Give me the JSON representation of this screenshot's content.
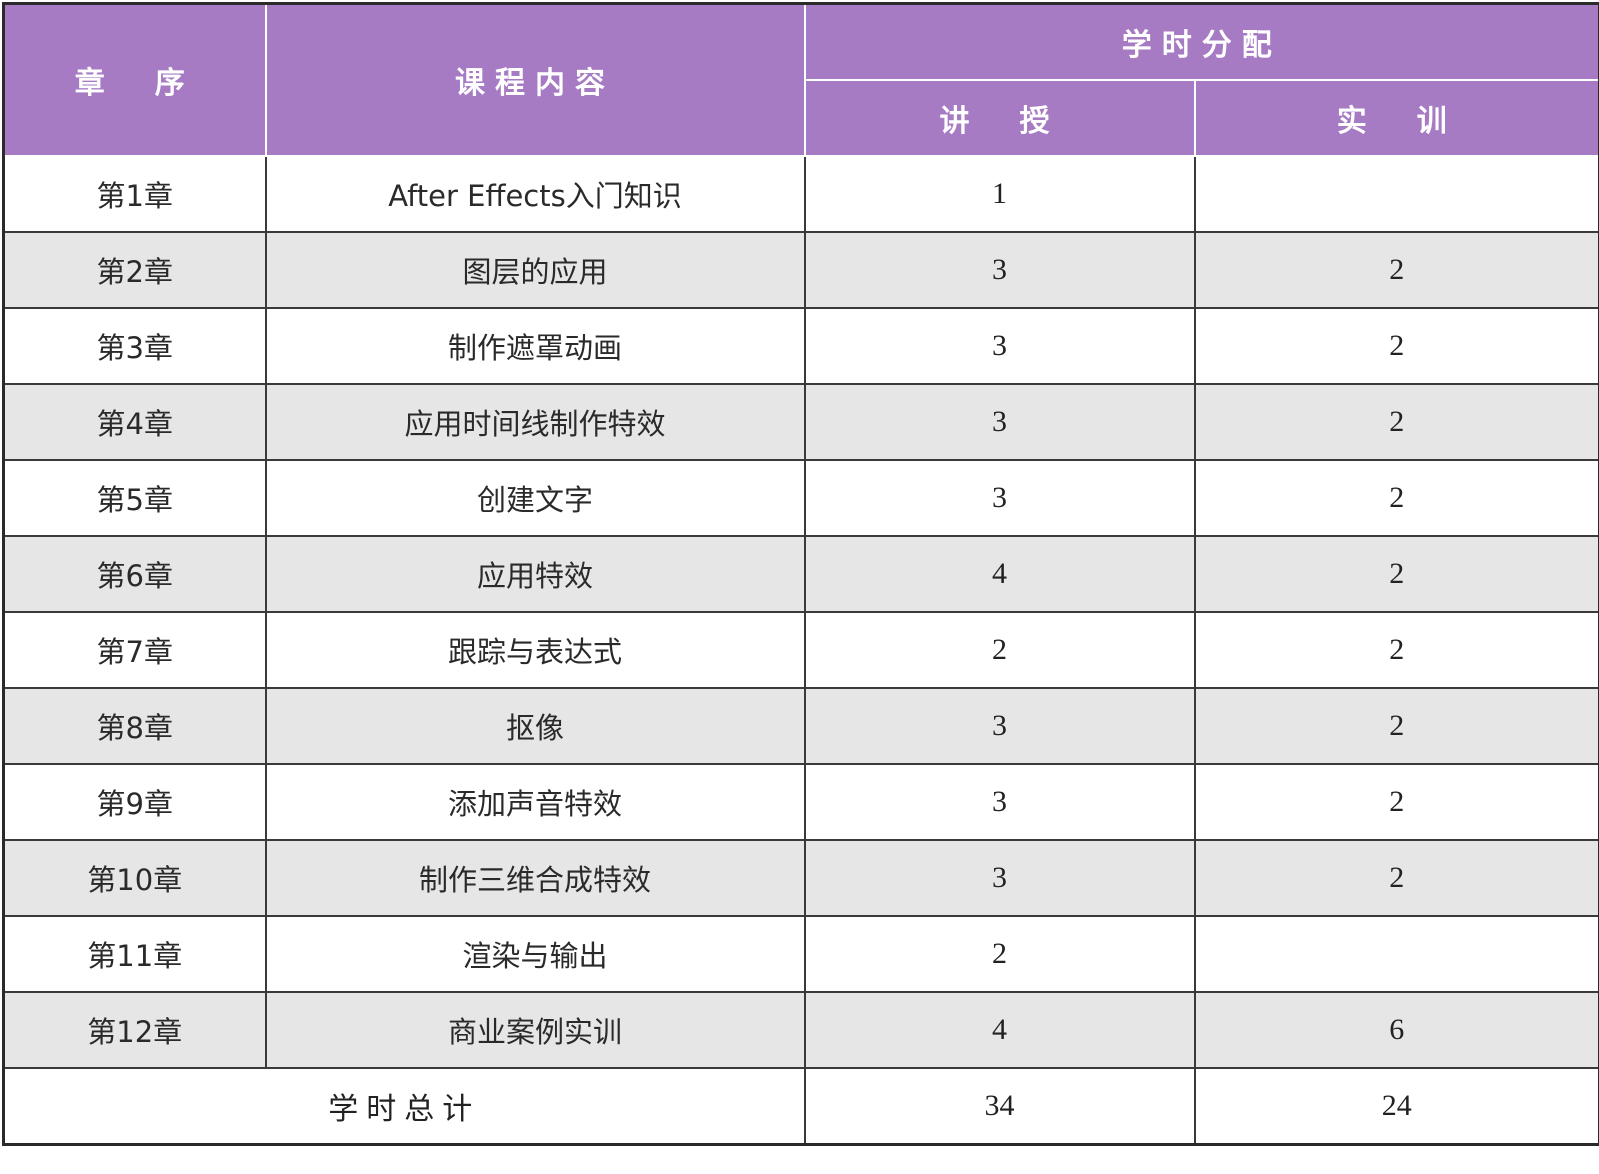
{
  "header": {
    "chapter": "章　序",
    "content": "课程内容",
    "hours_alloc": "学时分配",
    "lecture": "讲　授",
    "practice": "实　训"
  },
  "rows": [
    {
      "chapter": "第1章",
      "content": "After Effects入门知识",
      "lecture": "1",
      "practice": ""
    },
    {
      "chapter": "第2章",
      "content": "图层的应用",
      "lecture": "3",
      "practice": "2"
    },
    {
      "chapter": "第3章",
      "content": "制作遮罩动画",
      "lecture": "3",
      "practice": "2"
    },
    {
      "chapter": "第4章",
      "content": "应用时间线制作特效",
      "lecture": "3",
      "practice": "2"
    },
    {
      "chapter": "第5章",
      "content": "创建文字",
      "lecture": "3",
      "practice": "2"
    },
    {
      "chapter": "第6章",
      "content": "应用特效",
      "lecture": "4",
      "practice": "2"
    },
    {
      "chapter": "第7章",
      "content": "跟踪与表达式",
      "lecture": "2",
      "practice": "2"
    },
    {
      "chapter": "第8章",
      "content": "抠像",
      "lecture": "3",
      "practice": "2"
    },
    {
      "chapter": "第9章",
      "content": "添加声音特效",
      "lecture": "3",
      "practice": "2"
    },
    {
      "chapter": "第10章",
      "content": "制作三维合成特效",
      "lecture": "3",
      "practice": "2"
    },
    {
      "chapter": "第11章",
      "content": "渲染与输出",
      "lecture": "2",
      "practice": ""
    },
    {
      "chapter": "第12章",
      "content": "商业案例实训",
      "lecture": "4",
      "practice": "6"
    }
  ],
  "footer": {
    "label": "学时总计",
    "lecture_total": "34",
    "practice_total": "24"
  },
  "colors": {
    "header_bg": "#a67bc4",
    "header_text": "#ffffff",
    "alt_row_bg": "#e6e6e6",
    "border": "#3a3a3a"
  }
}
